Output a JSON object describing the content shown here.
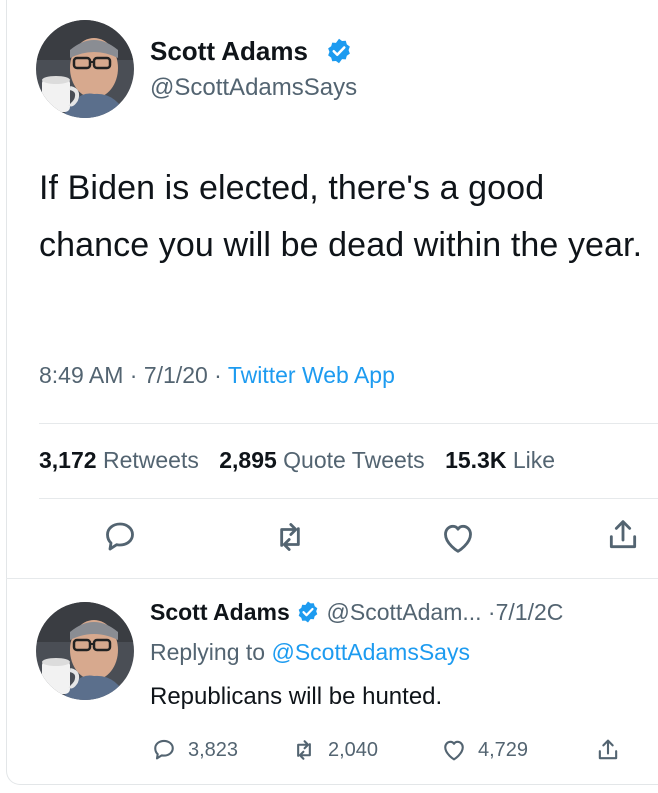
{
  "tweet": {
    "author_name": "Scott Adams",
    "handle": "@ScottAdamsSays",
    "text": "If Biden is elected, there's a good chance you will be dead within the year.",
    "time": "8:49 AM",
    "date": "7/1/20",
    "source": "Twitter Web App",
    "stats": {
      "retweets_count": "3,172",
      "retweets_label": "Retweets",
      "quotes_count": "2,895",
      "quotes_label": "Quote Tweets",
      "likes_count": "15.3K",
      "likes_label": "Like"
    },
    "actions": {
      "reply_icon": "reply-icon",
      "retweet_icon": "retweet-icon",
      "like_icon": "heart-icon",
      "share_icon": "share-icon"
    }
  },
  "reply": {
    "author_name": "Scott Adams",
    "handle": "@ScottAdam...",
    "date": "7/1/2C",
    "replying_to_label": "Replying to",
    "replying_to_handle": "@ScottAdamsSays",
    "text": "Republicans will be hunted.",
    "reply_count": "3,823",
    "retweet_count": "2,040",
    "like_count": "4,729"
  },
  "colors": {
    "accent": "#1d9bf0",
    "text": "#0f1419",
    "secondary": "#536471",
    "divider": "#e6e9eb"
  }
}
